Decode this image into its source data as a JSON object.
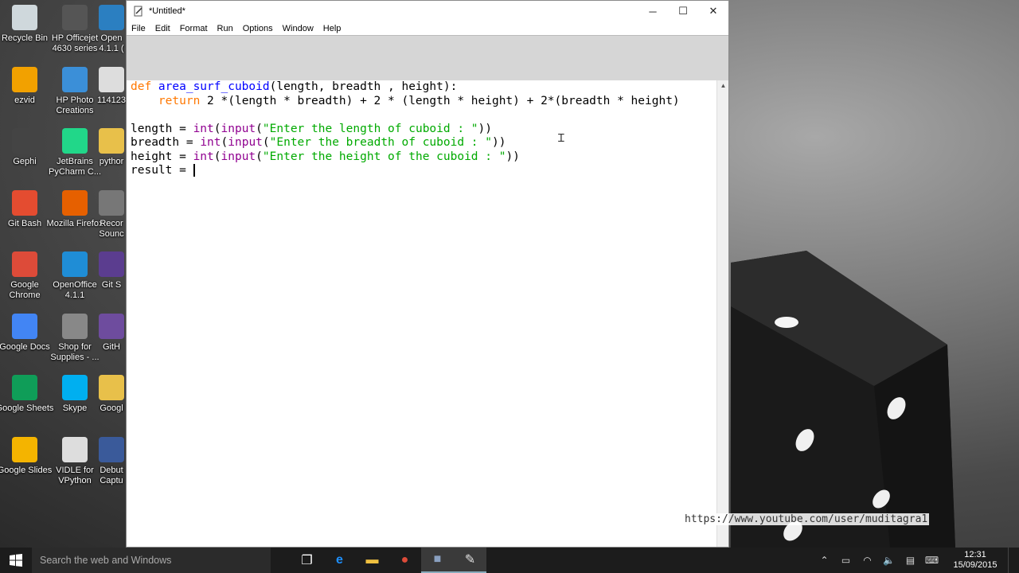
{
  "desktop": {
    "icons": [
      {
        "label": "Recycle Bin",
        "icon": "recycle-bin-icon",
        "color": "#cfd8dc"
      },
      {
        "label": "HP Officejet 4630 series",
        "icon": "printer-icon",
        "color": "#555555"
      },
      {
        "label": "Open 4.1.1 (",
        "icon": "openoffice-icon",
        "color": "#2b7fc1"
      },
      {
        "label": "ezvid",
        "icon": "ezvid-icon",
        "color": "#f2a100"
      },
      {
        "label": "HP Photo Creations",
        "icon": "hp-photo-icon",
        "color": "#3b8fd8"
      },
      {
        "label": "114123",
        "icon": "file-icon",
        "color": "#dddddd"
      },
      {
        "label": "Gephi",
        "icon": "gephi-icon",
        "color": "#444444"
      },
      {
        "label": "JetBrains PyCharm C...",
        "icon": "pycharm-icon",
        "color": "#21d789"
      },
      {
        "label": "pythor",
        "icon": "folder-icon",
        "color": "#e8c04a"
      },
      {
        "label": "Git Bash",
        "icon": "git-bash-icon",
        "color": "#e44c30"
      },
      {
        "label": "Mozilla Firefox",
        "icon": "firefox-icon",
        "color": "#e66000"
      },
      {
        "label": "Recor Sounc",
        "icon": "recorder-icon",
        "color": "#777777"
      },
      {
        "label": "Google Chrome",
        "icon": "chrome-icon",
        "color": "#dd4b39"
      },
      {
        "label": "OpenOffice 4.1.1",
        "icon": "openoffice-icon",
        "color": "#1f8dd6"
      },
      {
        "label": "Git S",
        "icon": "git-shell-icon",
        "color": "#5b3d8f"
      },
      {
        "label": "Google Docs",
        "icon": "google-docs-icon",
        "color": "#4285f4"
      },
      {
        "label": "Shop for Supplies - ...",
        "icon": "printer-icon",
        "color": "#888888"
      },
      {
        "label": "GitH",
        "icon": "github-icon",
        "color": "#6e4c9e"
      },
      {
        "label": "Google Sheets",
        "icon": "google-sheets-icon",
        "color": "#0f9d58"
      },
      {
        "label": "Skype",
        "icon": "skype-icon",
        "color": "#00aff0"
      },
      {
        "label": "Googl",
        "icon": "folder-icon",
        "color": "#e8c04a"
      },
      {
        "label": "Google Slides",
        "icon": "google-slides-icon",
        "color": "#f4b400"
      },
      {
        "label": "VIDLE for VPython",
        "icon": "vidle-icon",
        "color": "#dddddd"
      },
      {
        "label": "Debut Captu",
        "icon": "debut-icon",
        "color": "#3a5a9a"
      }
    ]
  },
  "window": {
    "title": "*Untitled*",
    "controls": {
      "minimize": "─",
      "maximize": "☐",
      "close": "✕"
    },
    "menu": [
      "File",
      "Edit",
      "Format",
      "Run",
      "Options",
      "Window",
      "Help"
    ]
  },
  "editor": {
    "lines": [
      [
        {
          "t": "def ",
          "c": "kw"
        },
        {
          "t": "area_surf_cuboid",
          "c": "fn"
        },
        {
          "t": "(length, breadth , height):",
          "c": ""
        }
      ],
      [
        {
          "t": "    ",
          "c": ""
        },
        {
          "t": "return",
          "c": "kw"
        },
        {
          "t": " 2 *(length * breadth) + 2 * (length * height) + 2*(breadth * height)",
          "c": ""
        }
      ],
      [],
      [
        {
          "t": "length = ",
          "c": ""
        },
        {
          "t": "int",
          "c": "bi"
        },
        {
          "t": "(",
          "c": ""
        },
        {
          "t": "input",
          "c": "bi"
        },
        {
          "t": "(",
          "c": ""
        },
        {
          "t": "\"Enter the length of cuboid : \"",
          "c": "st"
        },
        {
          "t": "))",
          "c": ""
        }
      ],
      [
        {
          "t": "breadth = ",
          "c": ""
        },
        {
          "t": "int",
          "c": "bi"
        },
        {
          "t": "(",
          "c": ""
        },
        {
          "t": "input",
          "c": "bi"
        },
        {
          "t": "(",
          "c": ""
        },
        {
          "t": "\"Enter the breadth of cuboid : \"",
          "c": "st"
        },
        {
          "t": "))",
          "c": ""
        }
      ],
      [
        {
          "t": "height = ",
          "c": ""
        },
        {
          "t": "int",
          "c": "bi"
        },
        {
          "t": "(",
          "c": ""
        },
        {
          "t": "input",
          "c": "bi"
        },
        {
          "t": "(",
          "c": ""
        },
        {
          "t": "\"Enter the height of the cuboid : \"",
          "c": "st"
        },
        {
          "t": "))",
          "c": ""
        }
      ],
      [
        {
          "t": "result = ",
          "c": ""
        },
        {
          "t": "",
          "c": "cursor"
        }
      ]
    ]
  },
  "watermark": "https://www.youtube.com/user/muditagra1",
  "taskbar": {
    "search_placeholder": "Search the web and Windows",
    "apps": [
      {
        "name": "task-view-icon",
        "glyph": "❐",
        "color": "#ffffff"
      },
      {
        "name": "edge-icon",
        "glyph": "e",
        "color": "#1e90ff"
      },
      {
        "name": "file-explorer-icon",
        "glyph": "▬",
        "color": "#f0c040"
      },
      {
        "name": "chrome-icon",
        "glyph": "●",
        "color": "#dd4b39"
      },
      {
        "name": "record-icon",
        "glyph": "■",
        "color": "#8aa0c0"
      },
      {
        "name": "idle-icon",
        "glyph": "✎",
        "color": "#e0e0e0"
      }
    ],
    "clock_time": "12:31",
    "clock_date": "15/09/2015"
  },
  "colors": {
    "keyword": "#ff7700",
    "function": "#0000ff",
    "builtin": "#900090",
    "string": "#00aa00"
  }
}
